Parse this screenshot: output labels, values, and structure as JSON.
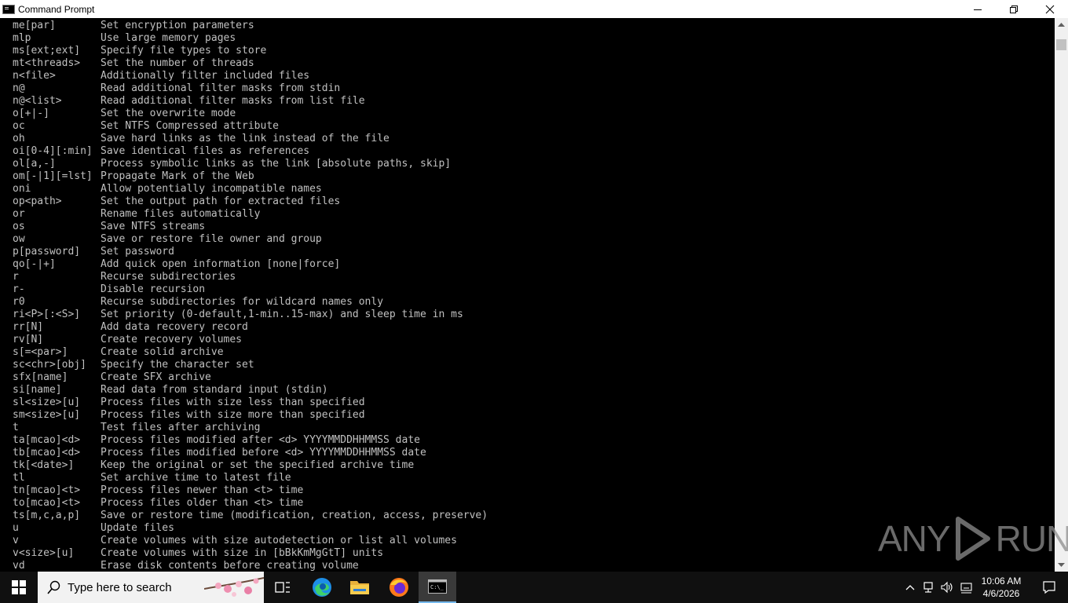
{
  "window": {
    "title": "Command Prompt",
    "minimize_glyph": "—",
    "close_glyph": "✕"
  },
  "console": {
    "lines": [
      {
        "switch": "me[par]",
        "desc": "Set encryption parameters"
      },
      {
        "switch": "mlp",
        "desc": "Use large memory pages"
      },
      {
        "switch": "ms[ext;ext]",
        "desc": "Specify file types to store"
      },
      {
        "switch": "mt<threads>",
        "desc": "Set the number of threads"
      },
      {
        "switch": "n<file>",
        "desc": "Additionally filter included files"
      },
      {
        "switch": "n@",
        "desc": "Read additional filter masks from stdin"
      },
      {
        "switch": "n@<list>",
        "desc": "Read additional filter masks from list file"
      },
      {
        "switch": "o[+|-]",
        "desc": "Set the overwrite mode"
      },
      {
        "switch": "oc",
        "desc": "Set NTFS Compressed attribute"
      },
      {
        "switch": "oh",
        "desc": "Save hard links as the link instead of the file"
      },
      {
        "switch": "oi[0-4][:min]",
        "desc": "Save identical files as references"
      },
      {
        "switch": "ol[a,-]",
        "desc": "Process symbolic links as the link [absolute paths, skip]"
      },
      {
        "switch": "om[-|1][=lst]",
        "desc": "Propagate Mark of the Web"
      },
      {
        "switch": "oni",
        "desc": "Allow potentially incompatible names"
      },
      {
        "switch": "op<path>",
        "desc": "Set the output path for extracted files"
      },
      {
        "switch": "or",
        "desc": "Rename files automatically"
      },
      {
        "switch": "os",
        "desc": "Save NTFS streams"
      },
      {
        "switch": "ow",
        "desc": "Save or restore file owner and group"
      },
      {
        "switch": "p[password]",
        "desc": "Set password"
      },
      {
        "switch": "qo[-|+]",
        "desc": "Add quick open information [none|force]"
      },
      {
        "switch": "r",
        "desc": "Recurse subdirectories"
      },
      {
        "switch": "r-",
        "desc": "Disable recursion"
      },
      {
        "switch": "r0",
        "desc": "Recurse subdirectories for wildcard names only"
      },
      {
        "switch": "ri<P>[:<S>]",
        "desc": "Set priority (0-default,1-min..15-max) and sleep time in ms"
      },
      {
        "switch": "rr[N]",
        "desc": "Add data recovery record"
      },
      {
        "switch": "rv[N]",
        "desc": "Create recovery volumes"
      },
      {
        "switch": "s[=<par>]",
        "desc": "Create solid archive"
      },
      {
        "switch": "sc<chr>[obj]",
        "desc": "Specify the character set"
      },
      {
        "switch": "sfx[name]",
        "desc": "Create SFX archive"
      },
      {
        "switch": "si[name]",
        "desc": "Read data from standard input (stdin)"
      },
      {
        "switch": "sl<size>[u]",
        "desc": "Process files with size less than specified"
      },
      {
        "switch": "sm<size>[u]",
        "desc": "Process files with size more than specified"
      },
      {
        "switch": "t",
        "desc": "Test files after archiving"
      },
      {
        "switch": "ta[mcao]<d>",
        "desc": "Process files modified after <d> YYYYMMDDHHMMSS date"
      },
      {
        "switch": "tb[mcao]<d>",
        "desc": "Process files modified before <d> YYYYMMDDHHMMSS date"
      },
      {
        "switch": "tk[<date>]",
        "desc": "Keep the original or set the specified archive time"
      },
      {
        "switch": "tl",
        "desc": "Set archive time to latest file"
      },
      {
        "switch": "tn[mcao]<t>",
        "desc": "Process files newer than <t> time"
      },
      {
        "switch": "to[mcao]<t>",
        "desc": "Process files older than <t> time"
      },
      {
        "switch": "ts[m,c,a,p]",
        "desc": "Save or restore time (modification, creation, access, preserve)"
      },
      {
        "switch": "u",
        "desc": "Update files"
      },
      {
        "switch": "v",
        "desc": "Create volumes with size autodetection or list all volumes"
      },
      {
        "switch": "v<size>[u]",
        "desc": "Create volumes with size in [bBkKmMgGtT] units"
      },
      {
        "switch": "vd",
        "desc": "Erase disk contents before creating volume"
      }
    ],
    "text_color": "#c0c0c0",
    "background": "#000000"
  },
  "watermark": {
    "left": "ANY",
    "right": "RUN"
  },
  "taskbar": {
    "search_placeholder": "Type here to search",
    "apps": [
      "task-view-icon",
      "edge-icon",
      "file-explorer-icon",
      "firefox-icon",
      "command-prompt-icon"
    ],
    "active_app": "command-prompt-icon",
    "clock_time": "10:06 AM",
    "clock_date": "4/6/2026",
    "accent": "#76b9ed"
  }
}
